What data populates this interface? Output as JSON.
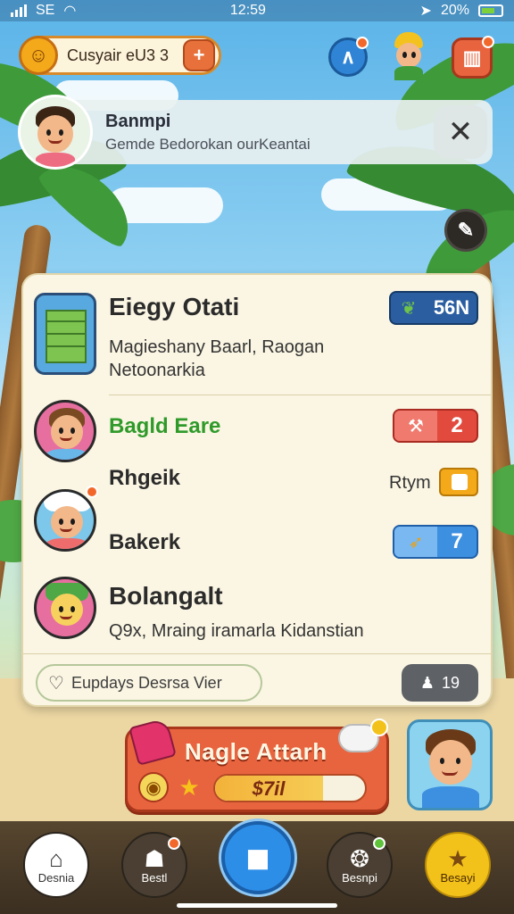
{
  "status_bar": {
    "carrier": "SE",
    "time": "12:59",
    "battery_percent": "20%"
  },
  "hud": {
    "coin_label": "Cusyair eU3 3",
    "coin_plus": "+",
    "top_buttons": [
      "caret-up",
      "helper-avatar",
      "gift"
    ]
  },
  "notification": {
    "title": "Banmpi",
    "subtitle": "Gemde Bedorokan ourKeantai",
    "close_label": "✕"
  },
  "panel": {
    "header": {
      "title": "Eiegy Otati",
      "description": "Magieshany Baarl, Raogan Netoonarkia",
      "chip_value": "56N"
    },
    "rows": [
      {
        "title": "Bagld Eare",
        "chip_value": "2",
        "chip_color": "#e24a3e"
      },
      {
        "title": "Rhgeik",
        "side_label": "Rtym"
      },
      {
        "title": "Bakerk",
        "chip_value": "7",
        "chip_color": "#3d8fe0"
      },
      {
        "title": "Bolangalt",
        "description": "Q9x, Mraing iramarla Kidanstian"
      }
    ],
    "footer": {
      "tag_label": "Eupdays Desrsa Vier",
      "count_label": "19"
    }
  },
  "attack": {
    "title": "Nagle Attarh",
    "bar_text": "$7il",
    "progress": 0.72
  },
  "bottom_nav": [
    {
      "label": "Desnia",
      "icon": "home-icon"
    },
    {
      "label": "Bestl",
      "icon": "turtle-icon"
    },
    {
      "label": "",
      "icon": "chat-icon"
    },
    {
      "label": "Besnpi",
      "icon": "seed-icon"
    },
    {
      "label": "Besayi",
      "icon": "star-icon"
    }
  ],
  "colors": {
    "accent_orange": "#e8643f",
    "panel_bg": "#fbf6e3",
    "nav_blue": "#2d8ee8"
  }
}
